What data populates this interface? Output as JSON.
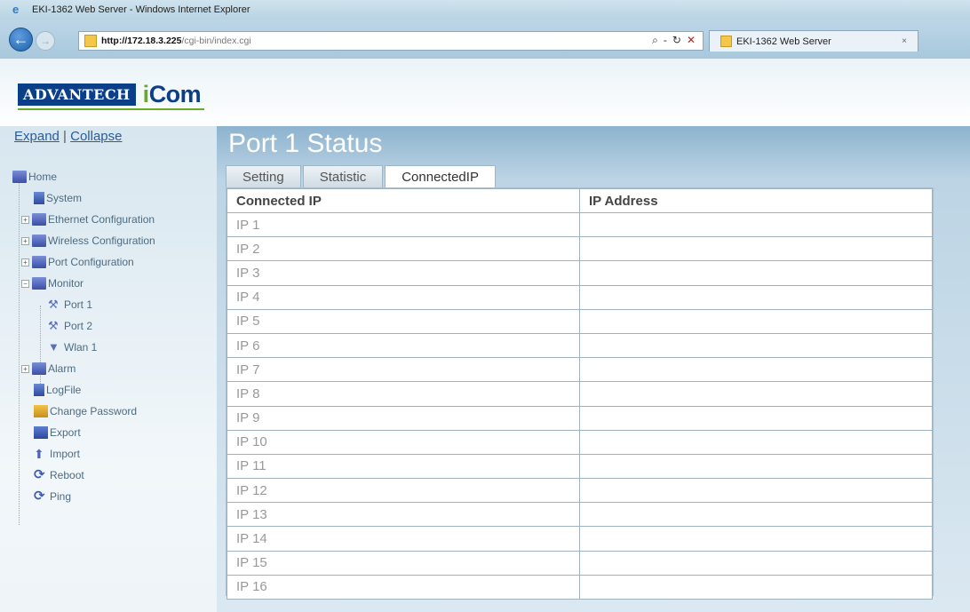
{
  "browser": {
    "window_title": "EKI-1362 Web Server - Windows Internet Explorer",
    "url_host": "http://172.18.3.225",
    "url_path": "/cgi-bin/index.cgi",
    "url_tools": {
      "search": "⌕",
      "sep": "-",
      "refresh": "↻",
      "stop": "✕"
    },
    "tab_title": "EKI-1362 Web Server",
    "tab_close": "×"
  },
  "logo": {
    "brand": "ADVANTECH",
    "product_prefix": "i",
    "product": "Com"
  },
  "sidebar": {
    "expand_label": "Expand",
    "separator": "|",
    "collapse_label": "Collapse",
    "items": [
      {
        "label": "Home",
        "icon": "folder-icon"
      },
      {
        "label": "System",
        "icon": "page-icon"
      },
      {
        "label": "Ethernet Configuration",
        "icon": "folder-icon"
      },
      {
        "label": "Wireless Configuration",
        "icon": "folder-icon"
      },
      {
        "label": "Port Configuration",
        "icon": "folder-icon"
      },
      {
        "label": "Monitor",
        "icon": "folder-open-icon"
      },
      {
        "label": "Port 1",
        "icon": "wrench-icon"
      },
      {
        "label": "Port 2",
        "icon": "wrench-icon"
      },
      {
        "label": "Wlan 1",
        "icon": "signal-icon"
      },
      {
        "label": "Alarm",
        "icon": "folder-icon"
      },
      {
        "label": "LogFile",
        "icon": "page-icon"
      },
      {
        "label": "Change Password",
        "icon": "key-icon"
      },
      {
        "label": "Export",
        "icon": "disk-icon"
      },
      {
        "label": "Import",
        "icon": "upload-icon"
      },
      {
        "label": "Reboot",
        "icon": "reboot-icon"
      },
      {
        "label": "Ping",
        "icon": "ping-icon"
      }
    ]
  },
  "main": {
    "title": "Port 1 Status",
    "tabs": [
      {
        "label": "Setting"
      },
      {
        "label": "Statistic"
      },
      {
        "label": "ConnectedIP"
      }
    ],
    "table": {
      "headers": [
        "Connected IP",
        "IP Address"
      ],
      "rows": [
        [
          "IP 1",
          ""
        ],
        [
          "IP 2",
          ""
        ],
        [
          "IP 3",
          ""
        ],
        [
          "IP 4",
          ""
        ],
        [
          "IP 5",
          ""
        ],
        [
          "IP 6",
          ""
        ],
        [
          "IP 7",
          ""
        ],
        [
          "IP 8",
          ""
        ],
        [
          "IP 9",
          ""
        ],
        [
          "IP 10",
          ""
        ],
        [
          "IP 11",
          ""
        ],
        [
          "IP 12",
          ""
        ],
        [
          "IP 13",
          ""
        ],
        [
          "IP 14",
          ""
        ],
        [
          "IP 15",
          ""
        ],
        [
          "IP 16",
          ""
        ]
      ]
    }
  },
  "colors": {
    "brand_blue": "#0c3f8a",
    "brand_green": "#6aaa2b",
    "link": "#2a5d9a"
  }
}
